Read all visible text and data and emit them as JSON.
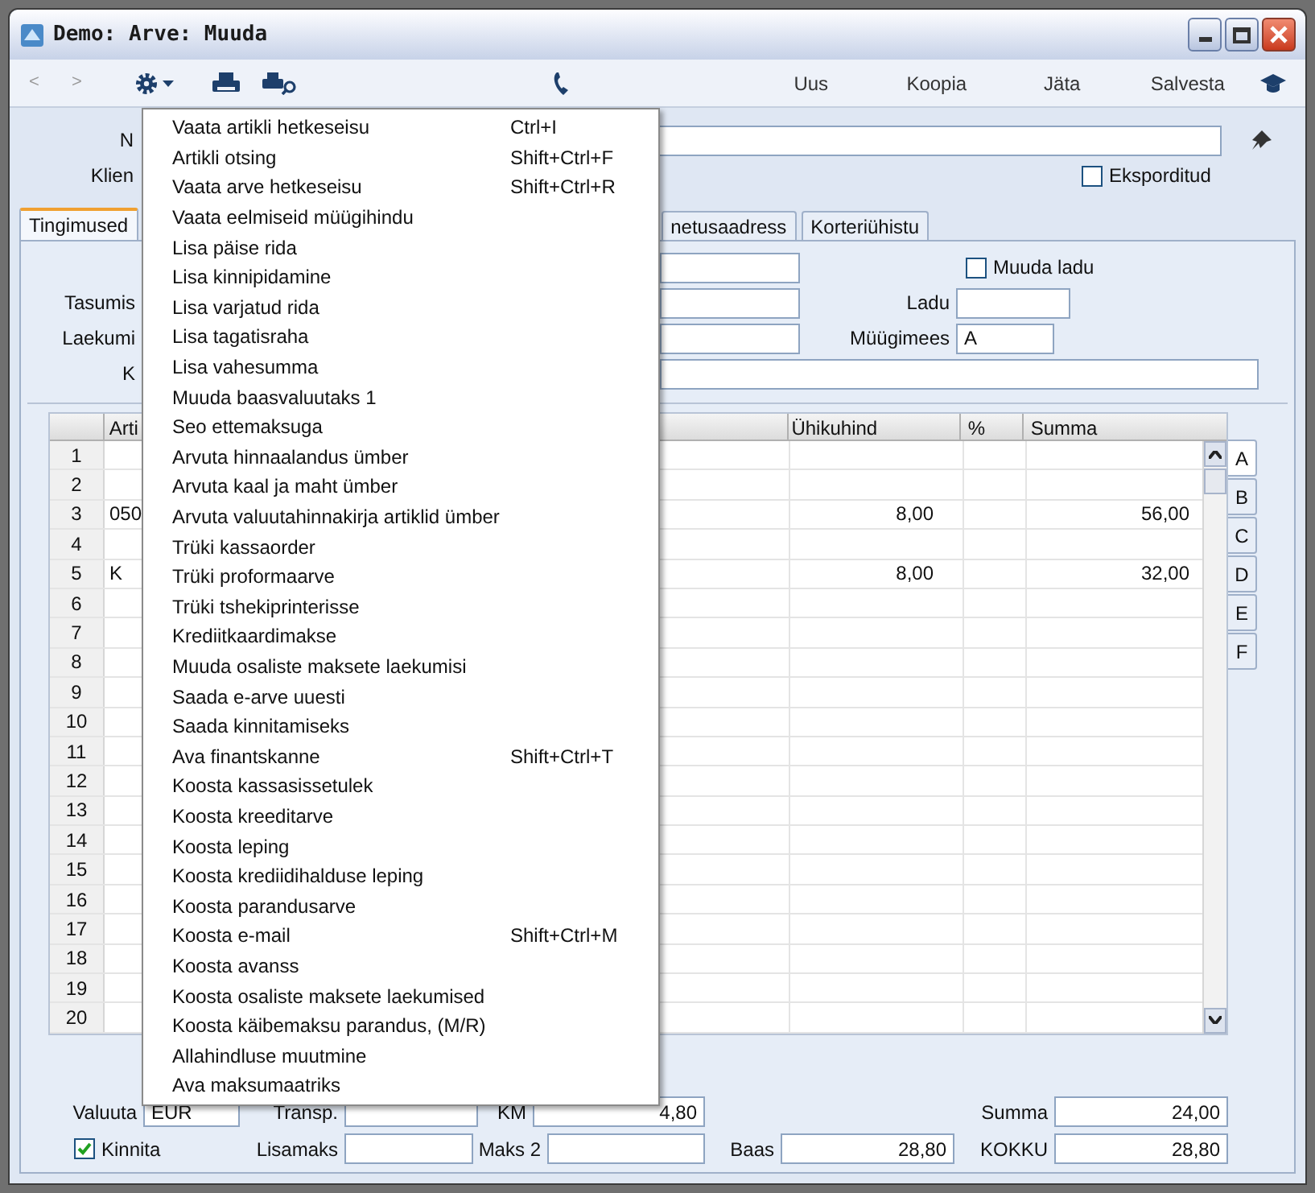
{
  "window": {
    "title": "Demo: Arve: Muuda"
  },
  "toolbar": {
    "back": "<",
    "forward": ">",
    "buttons": [
      "Uus",
      "Koopia",
      "Jäta",
      "Salvesta"
    ]
  },
  "header": {
    "label_1": "N",
    "label_2": "Klien",
    "eksporditud": {
      "label": "Eksporditud",
      "checked": false
    }
  },
  "tabs": [
    {
      "label": "Tingimused",
      "selected": true
    },
    {
      "label": "netusaadress",
      "selected": false
    },
    {
      "label": "Korteriühistu",
      "selected": false
    }
  ],
  "form": {
    "muuda_ladu": {
      "label": "Muuda ladu",
      "checked": false
    },
    "tasumis_label": "Tasumis",
    "ladu_label": "Ladu",
    "laekumi_label": "Laekumi",
    "myygimees_label": "Müügimees",
    "myygimees_value": "A",
    "k_label": "K"
  },
  "grid": {
    "columns": {
      "column_2": "Arti",
      "unit_price": "Ühikuhind",
      "percent": "%",
      "sum": "Summa"
    },
    "rows": [
      {
        "number": "1"
      },
      {
        "number": "2"
      },
      {
        "number": "3",
        "column_2": "050",
        "unit_price": "8,00",
        "sum": "56,00"
      },
      {
        "number": "4"
      },
      {
        "number": "5",
        "column_2": "K",
        "unit_price": "8,00",
        "sum": "32,00"
      },
      {
        "number": "6"
      },
      {
        "number": "7"
      },
      {
        "number": "8"
      },
      {
        "number": "9"
      },
      {
        "number": "10"
      },
      {
        "number": "11"
      },
      {
        "number": "12"
      },
      {
        "number": "13"
      },
      {
        "number": "14"
      },
      {
        "number": "15"
      },
      {
        "number": "16"
      },
      {
        "number": "17"
      },
      {
        "number": "18"
      },
      {
        "number": "19"
      },
      {
        "number": "20"
      }
    ]
  },
  "letter_tabs": [
    {
      "label": "A",
      "selected": true
    },
    {
      "label": "B",
      "selected": false
    },
    {
      "label": "C",
      "selected": false
    },
    {
      "label": "D",
      "selected": false
    },
    {
      "label": "E",
      "selected": false
    },
    {
      "label": "F",
      "selected": false
    }
  ],
  "footer": {
    "valuuta_label": "Valuuta",
    "valuuta": "EUR",
    "transp_label": "Transp.",
    "km_label": "KM",
    "km": "4,80",
    "summa_label": "Summa",
    "summa": "24,00",
    "kinnita": {
      "label": "Kinnita",
      "checked": true
    },
    "lisamaks_label": "Lisamaks",
    "maks2_label": "Maks 2",
    "baas_label": "Baas",
    "baas": "28,80",
    "kokku_label": "KOKKU",
    "kokku": "28,80"
  },
  "menu": [
    {
      "label": "Vaata artikli hetkeseisu",
      "shortcut": "Ctrl+I"
    },
    {
      "label": "Artikli otsing",
      "shortcut": "Shift+Ctrl+F"
    },
    {
      "label": "Vaata arve hetkeseisu",
      "shortcut": "Shift+Ctrl+R"
    },
    {
      "label": "Vaata eelmiseid müügihindu"
    },
    {
      "label": "Lisa päise rida"
    },
    {
      "label": "Lisa kinnipidamine"
    },
    {
      "label": "Lisa varjatud rida"
    },
    {
      "label": "Lisa tagatisraha"
    },
    {
      "label": "Lisa vahesumma"
    },
    {
      "label": "Muuda baasvaluutaks 1"
    },
    {
      "label": "Seo ettemaksuga"
    },
    {
      "label": "Arvuta hinnaalandus ümber"
    },
    {
      "label": "Arvuta kaal ja maht ümber"
    },
    {
      "label": "Arvuta valuutahinnakirja artiklid ümber"
    },
    {
      "label": "Trüki kassaorder"
    },
    {
      "label": "Trüki proformaarve"
    },
    {
      "label": "Trüki tshekiprinterisse"
    },
    {
      "label": "Krediitkaardimakse"
    },
    {
      "label": "Muuda osaliste maksete laekumisi"
    },
    {
      "label": "Saada e-arve uuesti"
    },
    {
      "label": "Saada kinnitamiseks"
    },
    {
      "label": "Ava finantskanne",
      "shortcut": "Shift+Ctrl+T"
    },
    {
      "label": "Koosta kassasissetulek"
    },
    {
      "label": "Koosta kreeditarve"
    },
    {
      "label": "Koosta leping"
    },
    {
      "label": "Koosta krediidihalduse leping"
    },
    {
      "label": "Koosta parandusarve"
    },
    {
      "label": "Koosta e-mail",
      "shortcut": "Shift+Ctrl+M"
    },
    {
      "label": "Koosta avanss"
    },
    {
      "label": "Koosta osaliste maksete laekumised"
    },
    {
      "label": "Koosta käibemaksu parandus, (M/R)"
    },
    {
      "label": "Allahindluse muutmine"
    },
    {
      "label": "Ava maksumaatriks"
    }
  ]
}
